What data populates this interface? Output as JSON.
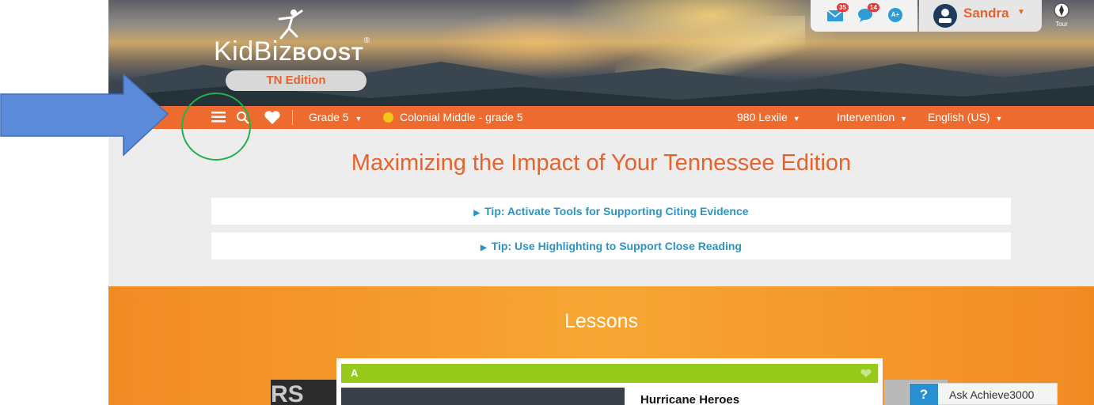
{
  "header": {
    "logo_main": "KidBiz",
    "logo_boost": "BOOST",
    "logo_reg": "®",
    "edition": "TN Edition",
    "notifications": [
      {
        "icon": "mail-icon",
        "count": "35"
      },
      {
        "icon": "chat-icon",
        "count": "14"
      },
      {
        "icon": "achievement-icon",
        "label": "A+"
      }
    ],
    "user_name": "Sandra",
    "tour_label": "Tour"
  },
  "nav": {
    "grade": "Grade 5",
    "class_name": "Colonial Middle - grade 5",
    "lexile": "980 Lexile",
    "program": "Intervention",
    "language": "English (US)"
  },
  "main": {
    "title": "Maximizing the Impact of Your Tennessee Edition",
    "tips": [
      "Tip: Activate Tools for Supporting Citing Evidence",
      "Tip: Use Highlighting to Support Close Reading"
    ]
  },
  "lessons": {
    "heading": "Lessons",
    "card": {
      "level": "A",
      "title": "Hurricane Heroes"
    },
    "left_card_text": "RS"
  },
  "help": {
    "icon": "?",
    "label": "Ask Achieve3000"
  },
  "colors": {
    "brand_orange": "#ee6b2f",
    "title_orange": "#e8622c",
    "tip_blue": "#2a94c3",
    "lesson_green": "#97c91b",
    "annotation_arrow": "#5b8bd8",
    "annotation_circle": "#22b04b"
  }
}
